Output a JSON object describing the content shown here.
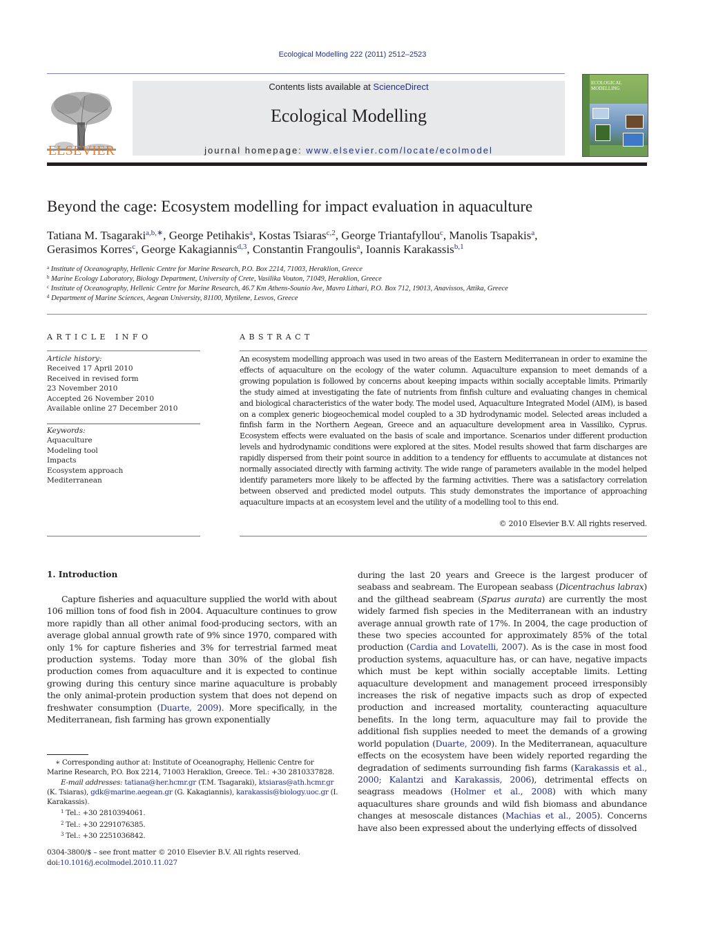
{
  "header": {
    "citation": "Ecological Modelling 222 (2011) 2512–2523",
    "contents_prefix": "Contents lists available at ",
    "contents_link": "ScienceDirect",
    "journal_title": "Ecological Modelling",
    "homepage_prefix": "journal homepage: ",
    "homepage_link": "www.elsevier.com/locate/ecolmodel",
    "publisher_logo_text": "ELSEVIER",
    "cover_title_1": "ECOLOGICAL",
    "cover_title_2": "MODELLING",
    "colors": {
      "link": "#1f2f8c",
      "elsevier_orange": "#f07c1f",
      "banner_bg": "#e8e9ea"
    }
  },
  "article": {
    "title": "Beyond the cage: Ecosystem modelling for impact evaluation in aquaculture",
    "authors_line1": [
      {
        "name": "Tatiana M. Tsagaraki",
        "sup": "a,b,∗",
        "sep": ", "
      },
      {
        "name": "George Petihakis",
        "sup": "a",
        "sep": ", "
      },
      {
        "name": "Kostas Tsiaras",
        "sup": "c,2",
        "sep": ", "
      },
      {
        "name": "George Triantafyllou",
        "sup": "c",
        "sep": ", "
      },
      {
        "name": "Manolis Tsapakis",
        "sup": "a",
        "sep": ","
      }
    ],
    "authors_line2": [
      {
        "name": "Gerasimos Korres",
        "sup": "c",
        "sep": ", "
      },
      {
        "name": "George Kakagiannis",
        "sup": "d,3",
        "sep": ", "
      },
      {
        "name": "Constantin Frangoulis",
        "sup": "a",
        "sep": ", "
      },
      {
        "name": "Ioannis Karakassis",
        "sup": "b,1",
        "sep": ""
      }
    ],
    "affiliations": [
      {
        "key": "a",
        "text": "Institute of Oceanography, Hellenic Centre for Marine Research, P.O. Box 2214, 71003, Heraklion, Greece"
      },
      {
        "key": "b",
        "text": "Marine Ecology Laboratory, Biology Department, University of Crete, Vasilika Vouton, 71049, Heraklion, Greece"
      },
      {
        "key": "c",
        "text": "Institute of Oceanography, Hellenic Centre for Marine Research, 46.7 Km Athens-Sounio Ave, Mavro Lithari, P.O. Box 712, 19013, Anavissos, Attika, Greece"
      },
      {
        "key": "d",
        "text": "Department of Marine Sciences, Aegean University, 81100, Mytilene, Lesvos, Greece"
      }
    ]
  },
  "article_info": {
    "heading": "ARTICLE INFO",
    "history_label": "Article history:",
    "history": [
      "Received 17 April 2010",
      "Received in revised form",
      "23 November 2010",
      "Accepted 26 November 2010",
      "Available online 27 December 2010"
    ],
    "keywords_label": "Keywords:",
    "keywords": [
      "Aquaculture",
      "Modeling tool",
      "Impacts",
      "Ecosystem approach",
      "Mediterranean"
    ]
  },
  "abstract": {
    "heading": "ABSTRACT",
    "text": "An ecosystem modelling approach was used in two areas of the Eastern Mediterranean in order to examine the effects of aquaculture on the ecology of the water column. Aquaculture expansion to meet demands of a growing population is followed by concerns about keeping impacts within socially acceptable limits. Primarily the study aimed at investigating the fate of nutrients from finfish culture and evaluating changes in chemical and biological characteristics of the water body. The model used, Aquaculture Integrated Model (AIM), is based on a complex generic biogeochemical model coupled to a 3D hydrodynamic model. Selected areas included a finfish farm in the Northern Aegean, Greece and an aquaculture development area in Vassiliko, Cyprus. Ecosystem effects were evaluated on the basis of scale and importance. Scenarios under different production levels and hydrodynamic conditions were explored at the sites. Model results showed that farm discharges are rapidly dispersed from their point source in addition to a tendency for effluents to accumulate at distances not normally associated directly with farming activity. The wide range of parameters available in the model helped identify parameters more likely to be affected by the farming activities. There was a satisfactory correlation between observed and predicted model outputs. This study demonstrates the importance of approaching aquaculture impacts at an ecosystem level and the utility of a modelling tool to this end.",
    "copyright": "© 2010 Elsevier B.V. All rights reserved."
  },
  "introduction": {
    "heading": "1.  Introduction",
    "left": {
      "p1": "Capture fisheries and aquaculture supplied the world with about 106 million tons of food fish in 2004. Aquaculture continues to grow more rapidly than all other animal food-producing sectors, with an average global annual growth rate of 9% since 1970, compared with only 1% for capture fisheries and 3% for terrestrial farmed meat production systems. Today more than 30% of the global fish production comes from aquaculture and it is expected to continue growing during this century since marine aquaculture is probably the only animal-protein production system that does not depend on freshwater consumption (",
      "cite1": "Duarte, 2009",
      "p1_end": "). More specifically, in the Mediterranean, fish farming has grown exponentially"
    },
    "right": {
      "t1": "during the last 20 years and Greece is the largest producer of seabass and seabream. The European seabass (",
      "sp1": "Dicentrachus labrax",
      "t2": ") and the gilthead seabream (",
      "sp2": "Sparus aurata",
      "t3": ") are currently the most widely farmed fish species in the Mediterranean with an industry average annual growth rate of 17%. In 2004, the cage production of these two species accounted for approximately 85% of the total production (",
      "c1": "Cardia and Lovatelli, 2007",
      "t4": "). As is the case in most food production systems, aquaculture has, or can have, negative impacts which must be kept within socially acceptable limits. Letting aquaculture development and management proceed irresponsibly increases the risk of negative impacts such as drop of expected production and increased mortality, counteracting aquaculture benefits. In the long term, aquaculture may fail to provide the additional fish supplies needed to meet the demands of a growing world population (",
      "c2": "Duarte, 2009",
      "t5": "). In the Mediterranean, aquaculture effects on the ecosystem have been widely reported regarding the degradation of sediments surrounding fish farms (",
      "c3": "Karakassis et al., 2000; Kalantzi and Karakassis, 2006",
      "t6": "), detrimental effects on seagrass meadows (",
      "c4": "Holmer et al., 2008",
      "t7": ") with which many aquacultures share grounds and wild fish biomass and abundance changes at mesoscale distances (",
      "c5": "Machias et al., 2005",
      "t8": "). Concerns have also been expressed about the underlying effects of dissolved"
    }
  },
  "footnotes": {
    "corresponding": "∗  Corresponding author at: Institute of Oceanography, Hellenic Centre for Marine Research, P.O. Box 2214, 71003 Heraklion, Greece. Tel.: +30 2810337828.",
    "email_label": "E-mail addresses:",
    "emails": [
      {
        "addr": "tatiana@her.hcmr.gr",
        "who": " (T.M. Tsagaraki), "
      },
      {
        "addr": "ktsiaras@ath.hcmr.gr",
        "who": " (K. Tsiaras), "
      },
      {
        "addr": "gdk@marine.aegean.gr",
        "who": " (G. Kakagiannis), "
      },
      {
        "addr": "karakassis@biology.uoc.gr",
        "who": " (I. Karakassis)."
      }
    ],
    "tel": [
      {
        "n": "1",
        "text": "Tel.: +30 2810394061."
      },
      {
        "n": "2",
        "text": "Tel.: +30 2291076385."
      },
      {
        "n": "3",
        "text": "Tel.: +30 2251036842."
      }
    ],
    "issn": "0304-3800/$ – see front matter © 2010 Elsevier B.V. All rights reserved.",
    "doi_prefix": "doi:",
    "doi": "10.1016/j.ecolmodel.2010.11.027"
  }
}
